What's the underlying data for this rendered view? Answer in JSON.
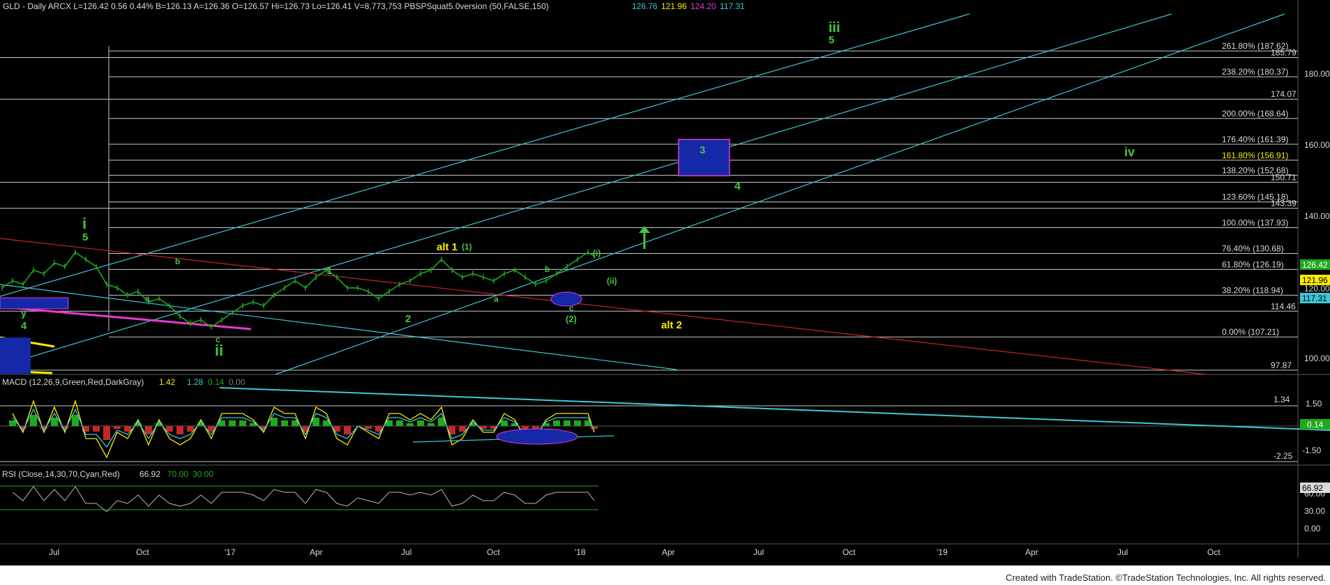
{
  "colors": {
    "bg": "#000000",
    "price": "#1fa91f",
    "cyan": "#3fc6d6",
    "red": "#c42828",
    "magenta": "#e63bd2",
    "yellow": "#ffea00",
    "green": "#43c743",
    "fib_line": "#c9c9c9",
    "macd_pos": "#1fa91f",
    "macd_neg": "#c42828",
    "box_blue": "#1428a8",
    "credit_bg": "#ffffff"
  },
  "header": {
    "symbol_line": "GLD - Daily  ARCX  L=126.42  0.56  0.44%  B=126.13  A=126.36  O=126.57  Hi=126.73  Lo=126.41  V=8,773,753  PBSPSquat5.0version (50,FALSE,150)",
    "v1": "126.76",
    "v2": "121.96",
    "v3": "124.20",
    "v4": "117.31"
  },
  "macd": {
    "label": "MACD (12,26,9,Green,Red,DarkGray)",
    "v1": "1.42",
    "v2": "1.28",
    "v3": "0.14",
    "v4": "0.00",
    "badge": "0.14",
    "ticks": [
      "1.50",
      "1.34",
      "0.00",
      "-1.50",
      "-2.25"
    ]
  },
  "rsi": {
    "label": "RSI (Close,14,30,70,Cyan,Red)",
    "v1": "66.92",
    "v2": "70.00",
    "v3": "30.00",
    "badge": "66.92",
    "ticks": [
      "60.00",
      "30.00",
      "0.00"
    ]
  },
  "x_axis": {
    "labels": [
      "Jul",
      "Oct",
      "'17",
      "Apr",
      "Jul",
      "Oct",
      "'18",
      "Apr",
      "Jul",
      "Oct",
      "'19",
      "Apr",
      "Jul",
      "Oct"
    ]
  },
  "price_axis": {
    "ticks": [
      "180.00",
      "160.00",
      "140.00",
      "120.00",
      "100.00"
    ],
    "badges": [
      "126.42",
      "121.96",
      "117.31"
    ]
  },
  "credit": "Created with TradeStation. ©TradeStation Technologies, Inc. All rights reserved.",
  "chart_data": {
    "type": "line",
    "title": "GLD - Daily",
    "ylim": [
      92,
      192
    ],
    "fib_levels": [
      {
        "label": "261.80% (187.62)",
        "value": 187.62
      },
      {
        "label": "185.79",
        "value": 185.79
      },
      {
        "label": "238.20% (180.37)",
        "value": 180.37
      },
      {
        "label": "174.07",
        "value": 174.07
      },
      {
        "label": "200.00% (168.64)",
        "value": 168.64
      },
      {
        "label": "176.40% (161.39)",
        "value": 161.39
      },
      {
        "label": "161.80% (156.91)",
        "value": 156.91
      },
      {
        "label": "150.71",
        "value": 150.71
      },
      {
        "label": "138.20% (152.68)",
        "value": 152.68
      },
      {
        "label": "123.60% (145.18)",
        "value": 145.18
      },
      {
        "label": "143.39",
        "value": 143.39
      },
      {
        "label": "100.00% (137.93)",
        "value": 137.93
      },
      {
        "label": "76.40% (130.68)",
        "value": 130.68
      },
      {
        "label": "61.80% (126.19)",
        "value": 126.19
      },
      {
        "label": "38.20% (118.94)",
        "value": 118.94
      },
      {
        "label": "114.46",
        "value": 114.46
      },
      {
        "label": "0.00% (107.21)",
        "value": 107.21
      },
      {
        "label": "97.87",
        "value": 97.87
      }
    ],
    "price_series": [
      [
        1,
        121
      ],
      [
        6,
        123
      ],
      [
        11,
        122
      ],
      [
        16,
        126
      ],
      [
        21,
        125
      ],
      [
        26,
        128
      ],
      [
        31,
        127
      ],
      [
        36,
        131
      ],
      [
        41,
        129
      ],
      [
        46,
        127
      ],
      [
        51,
        122
      ],
      [
        56,
        121
      ],
      [
        61,
        119
      ],
      [
        66,
        120
      ],
      [
        71,
        117
      ],
      [
        76,
        118
      ],
      [
        81,
        116
      ],
      [
        86,
        113
      ],
      [
        91,
        111
      ],
      [
        96,
        112
      ],
      [
        101,
        110
      ],
      [
        106,
        112
      ],
      [
        111,
        114
      ],
      [
        116,
        116
      ],
      [
        121,
        117
      ],
      [
        126,
        116
      ],
      [
        131,
        119
      ],
      [
        136,
        121
      ],
      [
        141,
        123
      ],
      [
        146,
        121
      ],
      [
        151,
        124
      ],
      [
        156,
        126
      ],
      [
        161,
        124
      ],
      [
        166,
        121
      ],
      [
        171,
        121
      ],
      [
        176,
        120
      ],
      [
        181,
        118
      ],
      [
        186,
        120
      ],
      [
        191,
        122
      ],
      [
        196,
        123
      ],
      [
        201,
        125
      ],
      [
        206,
        126
      ],
      [
        211,
        129
      ],
      [
        216,
        126
      ],
      [
        221,
        124
      ],
      [
        226,
        125
      ],
      [
        231,
        124
      ],
      [
        236,
        123
      ],
      [
        241,
        125
      ],
      [
        246,
        126
      ],
      [
        251,
        124
      ],
      [
        256,
        122
      ],
      [
        261,
        123
      ],
      [
        266,
        125
      ],
      [
        271,
        127
      ],
      [
        276,
        129
      ],
      [
        281,
        131
      ],
      [
        284,
        130
      ]
    ],
    "labels": [
      {
        "text": "iii",
        "color": "green",
        "value": "top"
      },
      {
        "text": "5",
        "color": "green"
      },
      {
        "text": "i",
        "color": "green"
      },
      {
        "text": "5",
        "color": "green"
      },
      {
        "text": "y",
        "color": "green"
      },
      {
        "text": "4",
        "color": "green"
      },
      {
        "text": "ii",
        "color": "green"
      },
      {
        "text": "c",
        "color": "green"
      },
      {
        "text": "a",
        "color": "green"
      },
      {
        "text": "b",
        "color": "green"
      },
      {
        "text": "1",
        "color": "green"
      },
      {
        "text": "2",
        "color": "green"
      },
      {
        "text": "alt 1",
        "color": "yellow"
      },
      {
        "text": "(1)",
        "color": "green"
      },
      {
        "text": "a",
        "color": "green"
      },
      {
        "text": "b",
        "color": "green"
      },
      {
        "text": "c",
        "color": "green"
      },
      {
        "text": "(2)",
        "color": "green"
      },
      {
        "text": "(i)",
        "color": "green"
      },
      {
        "text": "(ii)",
        "color": "green"
      },
      {
        "text": "3",
        "color": "green"
      },
      {
        "text": "4",
        "color": "green"
      },
      {
        "text": "iv",
        "color": "green"
      },
      {
        "text": "alt 2",
        "color": "yellow"
      }
    ]
  }
}
